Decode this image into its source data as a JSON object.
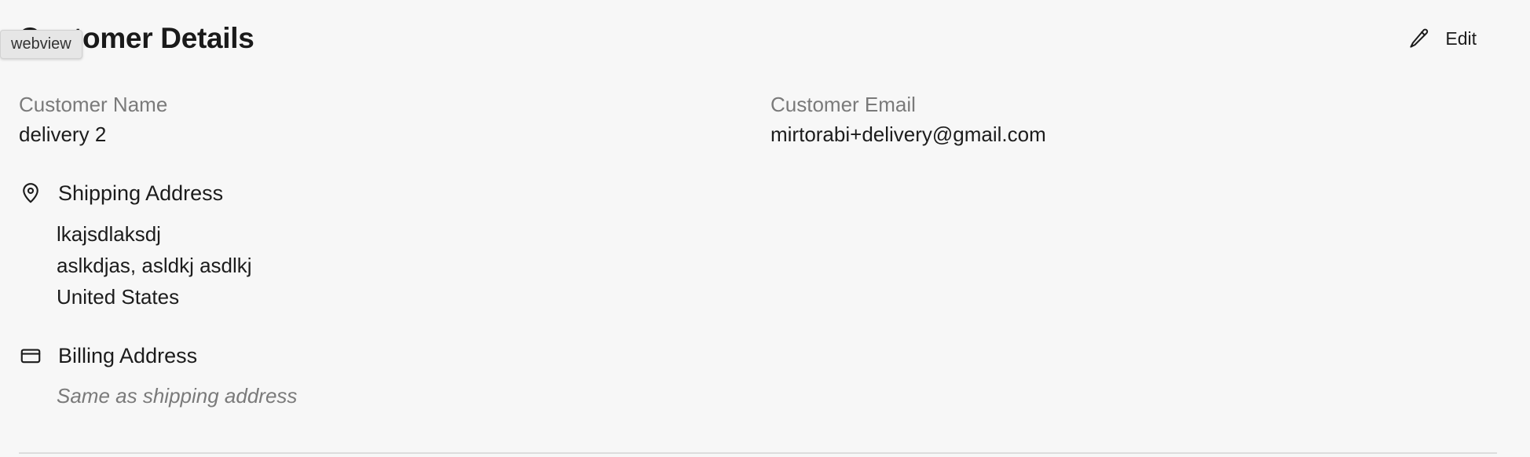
{
  "overlay": {
    "webview_label": "webview"
  },
  "header": {
    "title": "Customer Details",
    "edit_label": "Edit"
  },
  "customer": {
    "name_label": "Customer Name",
    "name_value": "delivery 2",
    "email_label": "Customer Email",
    "email_value": "mirtorabi+delivery@gmail.com"
  },
  "shipping": {
    "heading": "Shipping Address",
    "icon": "map-pin-icon",
    "lines": [
      "lkajsdlaksdj",
      "aslkdjas, asldkj asdlkj",
      "United States"
    ]
  },
  "billing": {
    "heading": "Billing Address",
    "icon": "credit-card-icon",
    "note": "Same as shipping address"
  }
}
